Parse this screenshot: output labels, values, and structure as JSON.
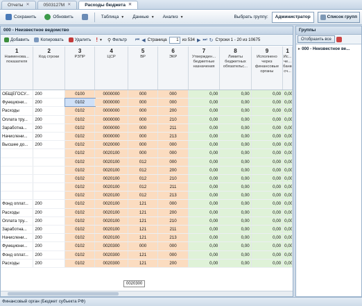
{
  "tabs": [
    {
      "label": "Отчеты",
      "active": false
    },
    {
      "label": "0503127М",
      "active": false
    },
    {
      "label": "Расходы бюджета",
      "active": true
    }
  ],
  "toolbar": {
    "save": "Сохранить",
    "refresh": "Обновить",
    "table": "Таблица",
    "data": "Данные",
    "analysis": "Анализ",
    "group_label": "Выбрать группу:",
    "group_value": "Администратор",
    "group_list": "Список групп"
  },
  "panel": {
    "title": "000 - Неизвестное ведомство",
    "add": "Добавить",
    "copy": "Копировать",
    "delete": "Удалить",
    "filter": "Фильтр",
    "page_label": "Страница",
    "page_value": "1",
    "page_of": "из 534",
    "rows_info": "Строки 1 - 20 из 10675"
  },
  "columns": [
    {
      "num": "1",
      "label": "Наименова... показателя"
    },
    {
      "num": "2",
      "label": "Код строки"
    },
    {
      "num": "3",
      "label": "РЗПР"
    },
    {
      "num": "4",
      "label": "ЦСР"
    },
    {
      "num": "5",
      "label": "ВР"
    },
    {
      "num": "6",
      "label": "ЭКР"
    },
    {
      "num": "7",
      "label": "Утвержден... бюджетные назначения"
    },
    {
      "num": "8",
      "label": "Лимиты бюджетных обязательс..."
    },
    {
      "num": "9",
      "label": "Исполнено через финансовые органы"
    },
    {
      "num": "1",
      "label": "Ис... че... банко... сч..."
    }
  ],
  "rows": [
    [
      "ОБЩЕГОСУ...",
      "200",
      "0100",
      "0000000",
      "000",
      "000",
      "0,00",
      "0,00",
      "0,00",
      "0,00"
    ],
    [
      "Функциони...",
      "200",
      "0102",
      "0000000",
      "000",
      "000",
      "0,00",
      "0,00",
      "0,00",
      "0,00"
    ],
    [
      "Расходы",
      "200",
      "0102",
      "0000000",
      "000",
      "200",
      "0,00",
      "0,00",
      "0,00",
      "0,00"
    ],
    [
      "Оплата тру...",
      "200",
      "0102",
      "0000000",
      "000",
      "210",
      "0,00",
      "0,00",
      "0,00",
      "0,00"
    ],
    [
      "Заработна...",
      "200",
      "0102",
      "0000000",
      "000",
      "211",
      "0,00",
      "0,00",
      "0,00",
      "0,00"
    ],
    [
      "Начислени...",
      "200",
      "0102",
      "0000000",
      "000",
      "213",
      "0,00",
      "0,00",
      "0,00",
      "0,00"
    ],
    [
      "Высшее до...",
      "200",
      "0102",
      "0020000",
      "000",
      "000",
      "0,00",
      "0,00",
      "0,00",
      "0,00"
    ],
    [
      "",
      "",
      "0102",
      "0020100",
      "000",
      "000",
      "0,00",
      "0,00",
      "0,00",
      "0,00"
    ],
    [
      "",
      "",
      "0102",
      "0020100",
      "012",
      "000",
      "0,00",
      "0,00",
      "0,00",
      "0,00"
    ],
    [
      "",
      "",
      "0102",
      "0020100",
      "012",
      "200",
      "0,00",
      "0,00",
      "0,00",
      "0,00"
    ],
    [
      "",
      "",
      "0102",
      "0020100",
      "012",
      "210",
      "0,00",
      "0,00",
      "0,00",
      "0,00"
    ],
    [
      "",
      "",
      "0102",
      "0020100",
      "012",
      "211",
      "0,00",
      "0,00",
      "0,00",
      "0,00"
    ],
    [
      "",
      "",
      "0102",
      "0020100",
      "012",
      "213",
      "0,00",
      "0,00",
      "0,00",
      "0,00"
    ],
    [
      "Фонд оплат...",
      "200",
      "0102",
      "0020100",
      "121",
      "000",
      "0,00",
      "0,00",
      "0,00",
      "0,00"
    ],
    [
      "Расходы",
      "200",
      "0102",
      "0020100",
      "121",
      "200",
      "0,00",
      "0,00",
      "0,00",
      "0,00"
    ],
    [
      "Оплата тру...",
      "200",
      "0102",
      "0020100",
      "121",
      "210",
      "0,00",
      "0,00",
      "0,00",
      "0,00"
    ],
    [
      "Заработна...",
      "200",
      "0102",
      "0020100",
      "121",
      "211",
      "0,00",
      "0,00",
      "0,00",
      "0,00"
    ],
    [
      "Начислени...",
      "200",
      "0102",
      "0020100",
      "121",
      "213",
      "0,00",
      "0,00",
      "0,00",
      "0,00"
    ],
    [
      "Функциони...",
      "200",
      "0102",
      "0020300",
      "000",
      "000",
      "0,00",
      "0,00",
      "0,00",
      "0,00"
    ],
    [
      "Фонд оплат...",
      "200",
      "0102",
      "0020300",
      "121",
      "000",
      "0,00",
      "0,00",
      "0,00",
      "0,00"
    ],
    [
      "Расходы",
      "200",
      "0102",
      "0020300",
      "121",
      "200",
      "0,00",
      "0,00",
      "0,00",
      "0,00"
    ]
  ],
  "tooltip": "0020300",
  "status": "Финансовый орган (Бюджет субъекта РФ)",
  "right": {
    "title": "Группы",
    "show_all": "Отобразить все",
    "tree_item": "000 - Неизвестное ве..."
  },
  "colors": {
    "orange": "#fbdcc0",
    "green": "#dff2d8",
    "blue": "#cfe0f7"
  }
}
